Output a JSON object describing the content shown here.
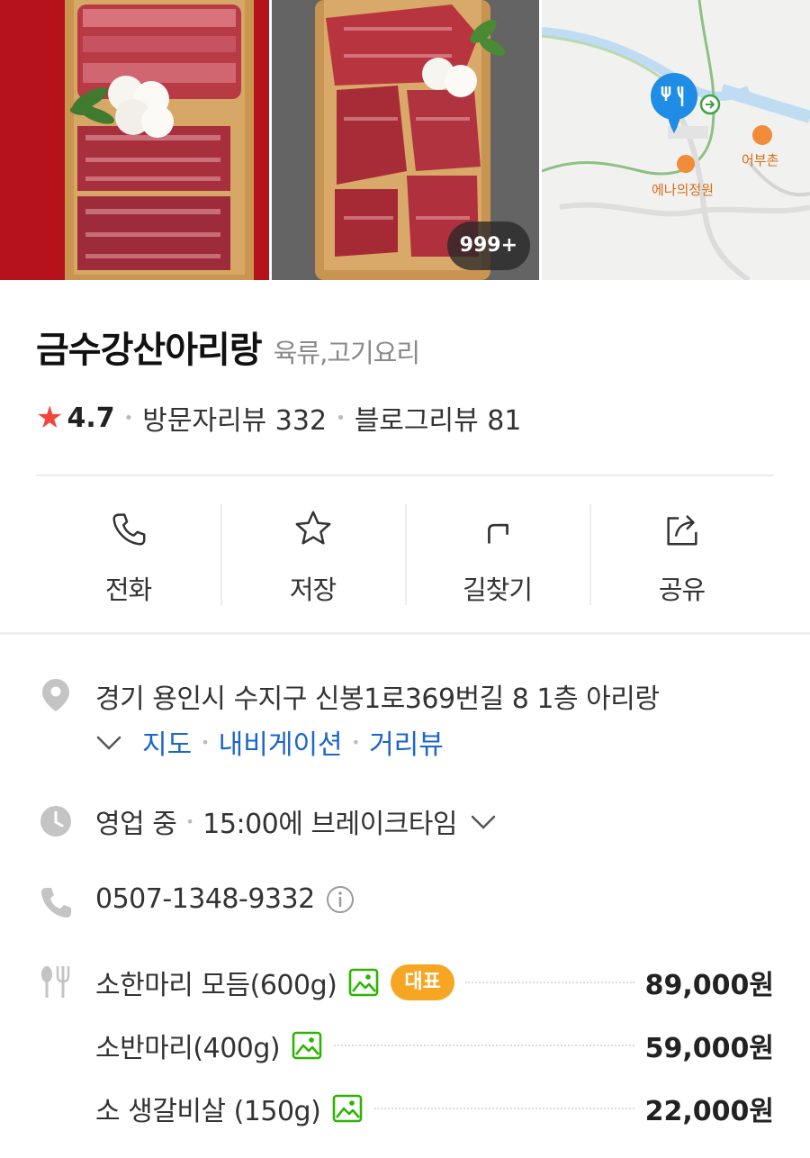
{
  "photos": {
    "count_badge": "999+",
    "map_labels": [
      "에나의정원",
      "어부촌"
    ]
  },
  "place": {
    "name": "금수강산아리랑",
    "category": "육류,고기요리",
    "rating": "4.7",
    "visitor_reviews": "방문자리뷰 332",
    "blog_reviews": "블로그리뷰 81"
  },
  "actions": [
    {
      "label": "전화",
      "icon": "phone-icon"
    },
    {
      "label": "저장",
      "icon": "star-icon"
    },
    {
      "label": "길찾기",
      "icon": "directions-icon"
    },
    {
      "label": "공유",
      "icon": "share-icon"
    }
  ],
  "info": {
    "address": "경기 용인시 수지구 신봉1로369번길 8 1층 아리랑",
    "address_links": [
      "지도",
      "내비게이션",
      "거리뷰"
    ],
    "hours_status": "영업 중",
    "hours_detail": "15:00에 브레이크타임",
    "phone": "0507-1348-9332"
  },
  "menu": [
    {
      "name": "소한마리 모듬(600g)",
      "badge": "대표",
      "price": "89,000원"
    },
    {
      "name": "소반마리(400g)",
      "price": "59,000원"
    },
    {
      "name": "소 생갈비살 (150g)",
      "price": "22,000원"
    }
  ],
  "colors": {
    "star": "#f1463c",
    "link": "#1a66c9",
    "rep_badge": "#f6a623",
    "photo_icon": "#2db400",
    "map_pin": "#1f8ce6"
  }
}
